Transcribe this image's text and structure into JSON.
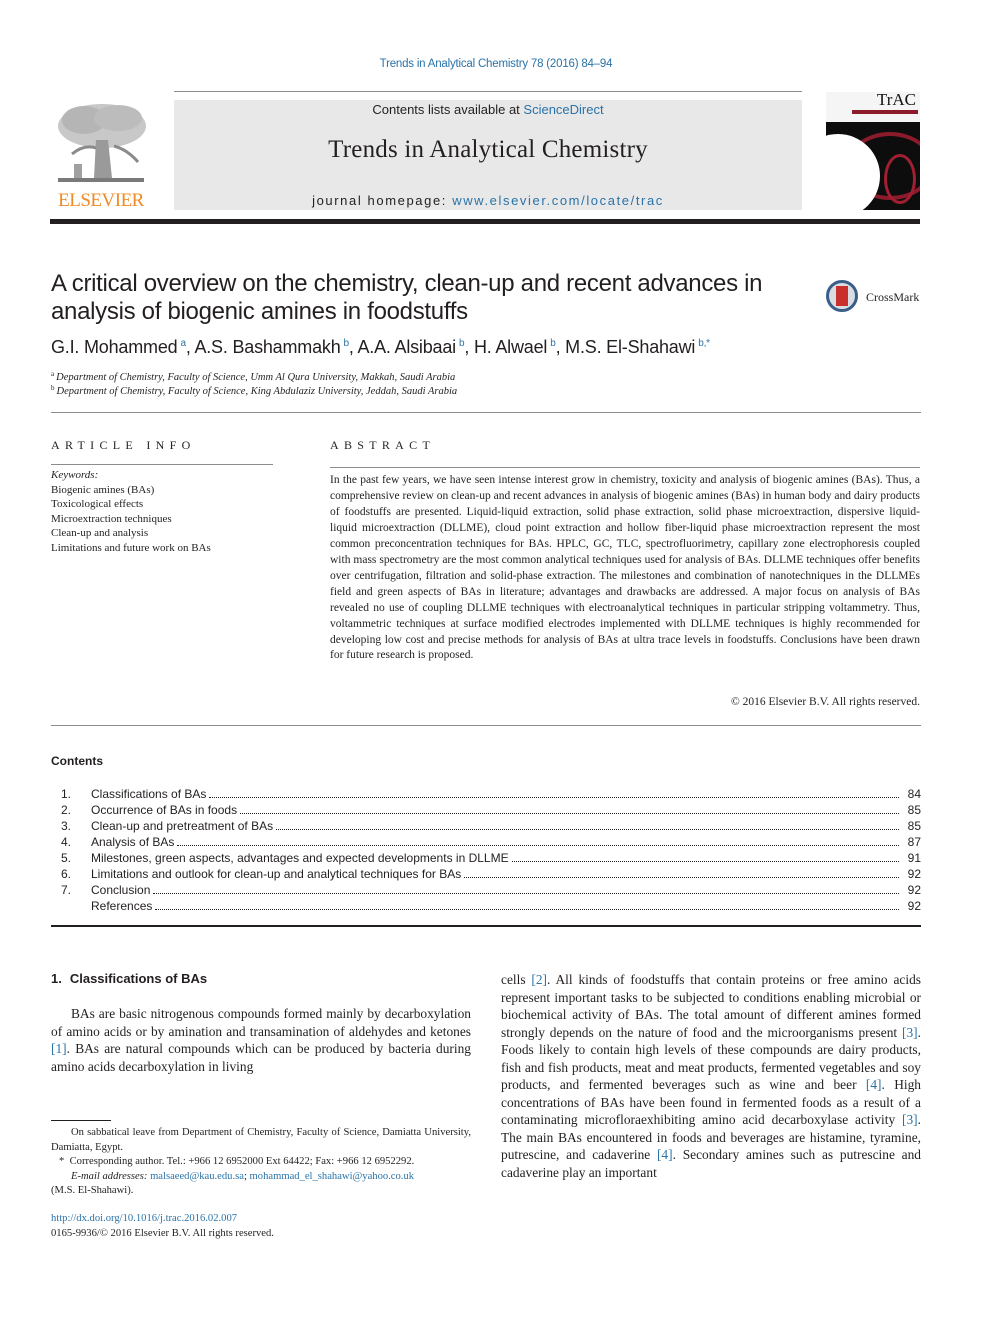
{
  "running_head": "Trends in Analytical Chemistry 78 (2016) 84–94",
  "masthead": {
    "publisher_logo_text": "ELSEVIER",
    "contents_prefix": "Contents lists available at ",
    "contents_link": "ScienceDirect",
    "journal_name": "Trends in Analytical Chemistry",
    "homepage_prefix": "journal homepage: ",
    "homepage_link": "www.elsevier.com/locate/trac",
    "cover_title": "TrAC",
    "brand_color": "#f08a24",
    "link_color": "#2a73a8"
  },
  "article": {
    "title": "A critical overview on the chemistry, clean-up and recent advances in analysis of biogenic amines in foodstuffs",
    "crossmark_label": "CrossMark",
    "authors": [
      {
        "name": "G.I. Mohammed",
        "affil": "a",
        "sep": ", "
      },
      {
        "name": "A.S. Bashammakh",
        "affil": "b",
        "sep": ", "
      },
      {
        "name": "A.A. Alsibaai",
        "affil": "b",
        "sep": ", "
      },
      {
        "name": "H. Alwael",
        "affil": "b",
        "sep": ", "
      },
      {
        "name": "M.S. El-Shahawi",
        "affil": "b,*",
        "sep": ""
      }
    ],
    "affiliations": [
      {
        "mark": "a",
        "text": "Department of Chemistry, Faculty of Science, Umm Al Qura University, Makkah, Saudi Arabia"
      },
      {
        "mark": "b",
        "text": "Department of Chemistry, Faculty of Science, King Abdulaziz University, Jeddah, Saudi Arabia"
      }
    ]
  },
  "article_info": {
    "heading": "ARTICLE INFO",
    "keywords_label": "Keywords:",
    "keywords": [
      "Biogenic amines (BAs)",
      "Toxicological effects",
      "Microextraction techniques",
      "Clean-up and analysis",
      "Limitations and future work on BAs"
    ]
  },
  "abstract": {
    "heading": "ABSTRACT",
    "text": "In the past few years, we have seen intense interest grow in chemistry, toxicity and analysis of biogenic amines (BAs). Thus, a comprehensive review on clean-up and recent advances in analysis of biogenic amines (BAs) in human body and dairy products of foodstuffs are presented. Liquid-liquid extraction, solid phase extraction, solid phase microextraction, dispersive liquid-liquid microextraction (DLLME), cloud point extraction and hollow fiber-liquid phase microextraction represent the most common preconcentration techniques for BAs. HPLC, GC, TLC, spectrofluorimetry, capillary zone electrophoresis coupled with mass spectrometry are the most common analytical techniques used for analysis of BAs. DLLME techniques offer benefits over centrifugation, filtration and solid-phase extraction. The milestones and combination of nanotechniques in the DLLMEs field and green aspects of BAs in literature; advantages and drawbacks are addressed. A major focus on analysis of BAs revealed no use of coupling DLLME techniques with electroanalytical techniques in particular stripping voltammetry. Thus, voltammetric techniques at surface modified electrodes implemented with DLLME techniques is highly recommended for developing low cost and precise methods for analysis of BAs at ultra trace levels in foodstuffs. Conclusions have been drawn for future research is proposed.",
    "copyright": "© 2016 Elsevier B.V. All rights reserved."
  },
  "contents": {
    "heading": "Contents",
    "items": [
      {
        "num": "1.",
        "label": "Classifications of BAs",
        "page": "84"
      },
      {
        "num": "2.",
        "label": "Occurrence of BAs in foods",
        "page": "85"
      },
      {
        "num": "3.",
        "label": "Clean-up and pretreatment of BAs",
        "page": "85"
      },
      {
        "num": "4.",
        "label": "Analysis of BAs",
        "page": "87"
      },
      {
        "num": "5.",
        "label": "Milestones, green aspects, advantages and expected developments in DLLME",
        "page": "91"
      },
      {
        "num": "6.",
        "label": "Limitations and outlook for clean-up and analytical techniques for BAs",
        "page": "92"
      },
      {
        "num": "7.",
        "label": "Conclusion",
        "page": "92"
      },
      {
        "num": "",
        "label": "References",
        "page": "92"
      }
    ]
  },
  "body": {
    "section1_num": "1.",
    "section1_title": "Classifications of BAs",
    "left_col": [
      {
        "t": "BAs are basic nitrogenous compounds formed mainly by decarboxylation of amino acids or by amination and transamination of aldehydes and ketones "
      },
      {
        "ref": "[1]"
      },
      {
        "t": ". BAs are natural compounds which can be produced by bacteria during amino acids decarboxylation in living"
      }
    ],
    "right_col": [
      {
        "t": "cells "
      },
      {
        "ref": "[2]"
      },
      {
        "t": ". All kinds of foodstuffs that contain proteins or free amino acids represent important tasks to be subjected to conditions enabling microbial or biochemical activity of BAs. The total amount of different amines formed strongly depends on the nature of food and the microorganisms present "
      },
      {
        "ref": "[3]"
      },
      {
        "t": ". Foods likely to contain high levels of these compounds are dairy products, fish and fish products, meat and meat products, fermented vegetables and soy products, and fermented beverages such as wine and beer "
      },
      {
        "ref": "[4]"
      },
      {
        "t": ". High concentrations of BAs have been found in fermented foods as a result of a contaminating microfloraexhibiting amino acid decarboxylase activity "
      },
      {
        "ref": "[3]"
      },
      {
        "t": ". The main BAs encountered in foods and beverages are histamine, tyramine, putrescine, and cadaverine "
      },
      {
        "ref": "[4]"
      },
      {
        "t": ". Secondary amines such as putrescine and cadaverine play an important"
      }
    ]
  },
  "footnotes": {
    "sabbatical": "On sabbatical leave from Department of Chemistry, Faculty of Science, Damiatta University, Damiatta, Egypt.",
    "corresponding_mark": "*",
    "corresponding": "Corresponding author. Tel.: +966 12 6952000 Ext 64422; Fax: +966 12 6952292.",
    "email_label": "E-mail addresses:",
    "email_1": "malsaeed@kau.edu.sa",
    "email_sep": "; ",
    "email_2": "mohammad_el_shahawi@yahoo.co.uk",
    "email_owner": "(M.S. El-Shahawi).",
    "doi": "http://dx.doi.org/10.1016/j.trac.2016.02.007",
    "issn_line": "0165-9936/© 2016 Elsevier B.V. All rights reserved."
  }
}
